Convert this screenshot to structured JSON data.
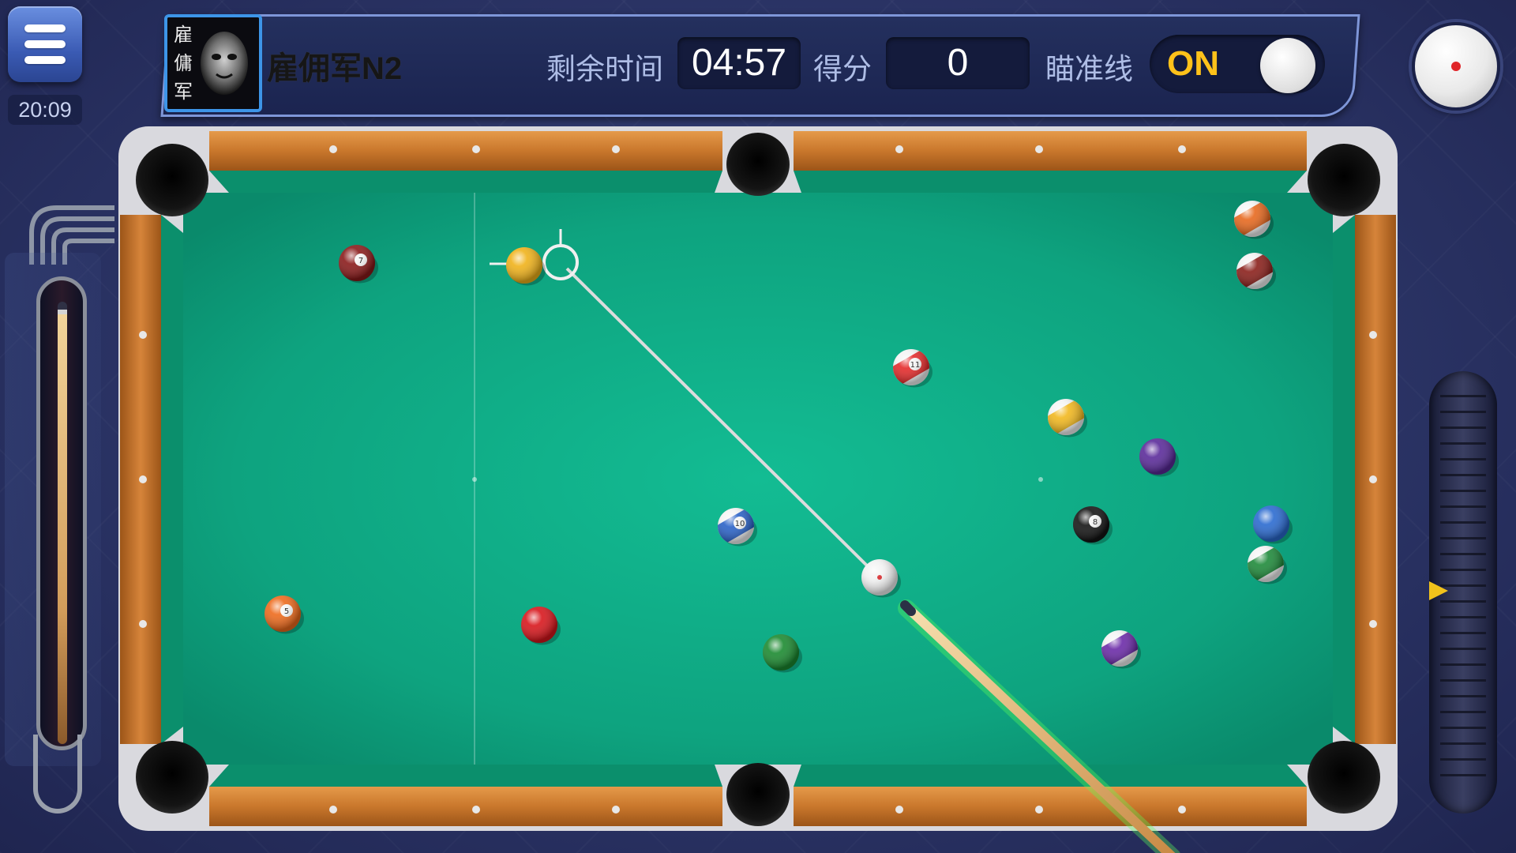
{
  "clock": "20:09",
  "player": {
    "name": "雇佣军N2",
    "avatar_text": "雇傭军"
  },
  "hud": {
    "time_label": "剩余时间",
    "time_value": "04:57",
    "score_label": "得分",
    "score_value": "0",
    "aim_label": "瞄准线",
    "aim_state": "ON"
  },
  "colors": {
    "felt": "#10b08a",
    "rail_wood": "#c97a2e",
    "accent_blue": "#3d95e8",
    "toggle_text": "#ffc21a"
  },
  "balls": [
    {
      "id": "cue",
      "color": "#f2f2f2",
      "stripe": false
    },
    {
      "id": "b-maroon-top-left",
      "color": "#8a1a1a",
      "stripe": false
    },
    {
      "id": "b-yellow-target",
      "color": "#f0b21a",
      "stripe": false
    },
    {
      "id": "b-red-stripe",
      "color": "#e52a2a",
      "stripe": true
    },
    {
      "id": "b-yellow-stripe",
      "color": "#f2b81e",
      "stripe": true
    },
    {
      "id": "b-purple",
      "color": "#5a2a9a",
      "stripe": false
    },
    {
      "id": "b-black-8",
      "color": "#141414",
      "stripe": false
    },
    {
      "id": "b-blue",
      "color": "#2a6ad0",
      "stripe": false
    },
    {
      "id": "b-green-stripe",
      "color": "#1e8a3a",
      "stripe": true
    },
    {
      "id": "b-purple-stripe",
      "color": "#6b2aa8",
      "stripe": true
    },
    {
      "id": "b-blue-stripe-10",
      "color": "#2a62c8",
      "stripe": true
    },
    {
      "id": "b-orange-5",
      "color": "#ee6a1c",
      "stripe": false
    },
    {
      "id": "b-red",
      "color": "#d8161c",
      "stripe": false
    },
    {
      "id": "b-green",
      "color": "#1b8a30",
      "stripe": false
    },
    {
      "id": "b-orange-stripe",
      "color": "#e7681e",
      "stripe": true
    },
    {
      "id": "b-maroon-stripe",
      "color": "#8a1f1a",
      "stripe": true
    }
  ],
  "ball_numbers": {
    "b-maroon-top-left": "7",
    "b-red-stripe": "11",
    "b-black-8": "8",
    "b-blue-stripe-10": "10",
    "b-orange-5": "5"
  }
}
